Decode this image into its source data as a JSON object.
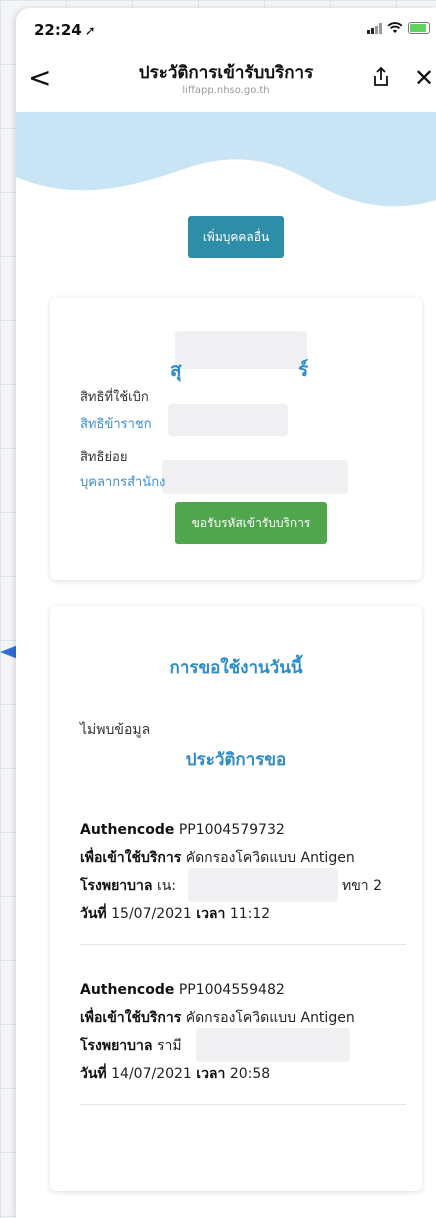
{
  "status_bar": {
    "time": "22:24"
  },
  "nav": {
    "back": "<",
    "title": "ประวัติการเข้ารับบริการ",
    "url": "liffapp.nhso.go.th",
    "close": "✕"
  },
  "add_person_button": "เพิ่มบุคคลอื่น",
  "profile": {
    "name_start": "สุ",
    "name_end": "ร์",
    "right_label": "สิทธิที่ใช้เบิก",
    "right_value": "สิทธิข้าราชก",
    "sub_right_label": "สิทธิย่อย",
    "sub_right_value": "บุคลากรสำนักง",
    "request_button": "ขอรับรหัสเข้ารับบริการ"
  },
  "today": {
    "heading": "การขอใช้งานวันนี้",
    "empty_text": "ไม่พบข้อมูล"
  },
  "history": {
    "heading": "ประวัติการขอ",
    "labels": {
      "authencode": "Authencode",
      "purpose": "เพื่อเข้าใช้บริการ",
      "hospital": "โรงพยาบาล",
      "date": "วันที่",
      "time": "เวลา"
    },
    "records": [
      {
        "authencode": "PP1004579732",
        "purpose": "คัดกรองโควิดแบบ Antigen",
        "hospital_start": "เน:",
        "hospital_end": "ทขา 2",
        "date": "15/07/2021",
        "time": "11:12"
      },
      {
        "authencode": "PP1004559482",
        "purpose": "คัดกรองโควิดแบบ Antigen",
        "hospital_start": "รามี",
        "hospital_end": "",
        "date": "14/07/2021",
        "time": "20:58"
      }
    ]
  },
  "colors": {
    "primary_blue": "#2c8cc6",
    "teal_button": "#2e8ea8",
    "green_button": "#4fa64c",
    "wave": "#c9e4f4"
  }
}
